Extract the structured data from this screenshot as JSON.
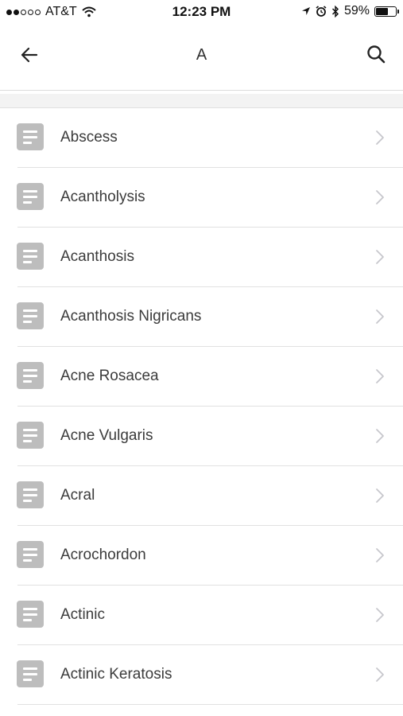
{
  "status_bar": {
    "carrier": "AT&T",
    "time": "12:23 PM",
    "battery_percent": "59%",
    "battery_level": 0.59,
    "signal_bars_filled": 2,
    "signal_bars_total": 5,
    "icons": [
      "wifi-icon",
      "location-icon",
      "alarm-icon",
      "bluetooth-icon",
      "battery-icon"
    ]
  },
  "nav": {
    "title": "A",
    "back_icon": "back-arrow-icon",
    "search_icon": "search-icon"
  },
  "colors": {
    "icon_gray": "#bdbdbd",
    "text": "#3b3b3b",
    "divider": "#e1e1e1",
    "chevron": "#c7c7cc"
  },
  "list": {
    "items": [
      {
        "label": "Abscess"
      },
      {
        "label": "Acantholysis"
      },
      {
        "label": "Acanthosis"
      },
      {
        "label": "Acanthosis Nigricans"
      },
      {
        "label": "Acne Rosacea"
      },
      {
        "label": "Acne Vulgaris"
      },
      {
        "label": "Acral"
      },
      {
        "label": "Acrochordon"
      },
      {
        "label": "Actinic"
      },
      {
        "label": "Actinic Keratosis"
      }
    ]
  }
}
